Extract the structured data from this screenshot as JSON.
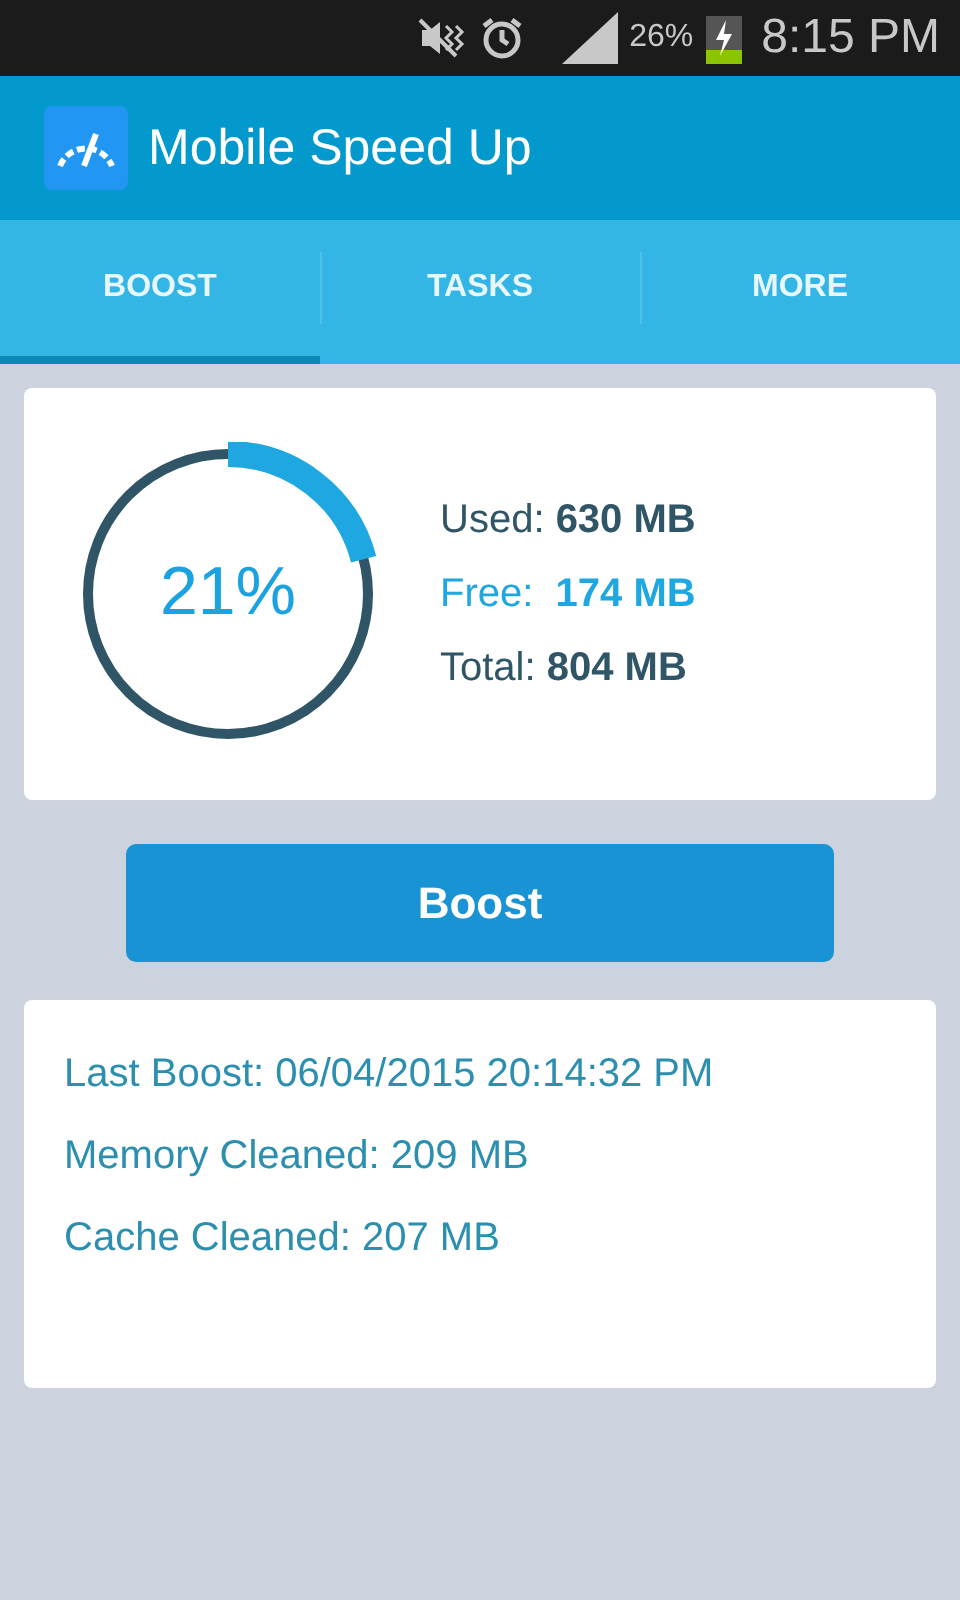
{
  "status_bar": {
    "battery": "26%",
    "time": "8:15 PM"
  },
  "app_bar": {
    "title": "Mobile Speed Up"
  },
  "tabs": [
    {
      "label": "BOOST",
      "selected": true
    },
    {
      "label": "TASKS",
      "selected": false
    },
    {
      "label": "MORE",
      "selected": false
    }
  ],
  "memory_card": {
    "level": 0.21,
    "percent": "21%",
    "stats": [
      {
        "text": "Used: **630 MB**",
        "color": "#2f5566"
      },
      {
        "text": "Free:  **174 MB**",
        "color": "#1ea7e1"
      },
      {
        "text": "Total: **804 MB**",
        "color": "#2f5566"
      }
    ]
  },
  "boost_button": "Boost",
  "history": [
    "Last Boost: 06/04/2015 20:14:32 PM",
    "Memory Cleaned: 209 MB",
    "Cache Cleaned: 207 MB"
  ]
}
